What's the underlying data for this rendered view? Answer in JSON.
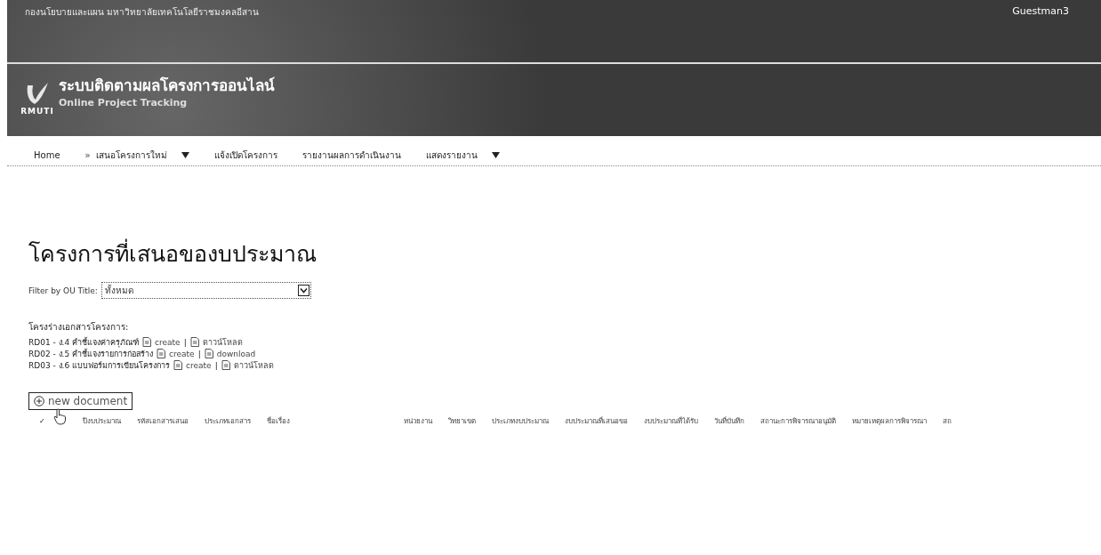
{
  "top_bar": {
    "organization": "กองนโยบายและแผน มหาวิทยาลัยเทคโนโลยีราชมงคลอีสาน",
    "user": "Guestman3"
  },
  "brand": {
    "logo_text": "RMUTI",
    "title": "ระบบติดตามผลโครงการออนไลน์",
    "subtitle": "Online Project Tracking"
  },
  "nav": [
    {
      "label": "Home",
      "dropdown": false
    },
    {
      "label": "เสนอโครงการใหม่",
      "prefix": "»",
      "dropdown": true
    },
    {
      "label": "แจ้งเปิดโครงการ",
      "dropdown": false
    },
    {
      "label": "รายงานผลการดำเนินงาน",
      "dropdown": false
    },
    {
      "label": "แสดงรายงาน",
      "dropdown": true
    }
  ],
  "page_title": "โครงการที่เสนอของบประมาณ",
  "filter": {
    "label": "Filter by OU Title:",
    "value": "ทั้งหมด"
  },
  "templates": {
    "heading": "โครงร่างเอกสารโครงการ:",
    "items": [
      {
        "name": "RD01 - ง.4 คำชี้แจงค่าครุภัณฑ์",
        "create": "create",
        "separator": "|",
        "download": "ดาวน์โหลด"
      },
      {
        "name": "RD02 - ง.5 คำชี้แจงรายการก่อสร้าง",
        "create": "create",
        "separator": "|",
        "download": "download"
      },
      {
        "name": "RD03 - ง.6 แบบฟอร์มการเขียนโครงการ",
        "create": "create",
        "separator": "|",
        "download": "ดาวน์โหลด"
      }
    ]
  },
  "new_document": "new document",
  "table": {
    "columns": [
      "✓",
      "ปีงบประมาณ",
      "รหัสเอกสารเสนอ",
      "ประเภทเอกสาร",
      "ชื่อเรื่อง",
      "หน่วยงาน",
      "วิทยาเขต",
      "ประเภทงบประมาณ",
      "งบประมาณที่เสนอขอ",
      "งบประมาณที่ได้รับ",
      "วันที่บันทึก",
      "สถานะการพิจารณาอนุมัติ",
      "หมายเหตุผลการพิจารณา",
      "สถ"
    ]
  }
}
